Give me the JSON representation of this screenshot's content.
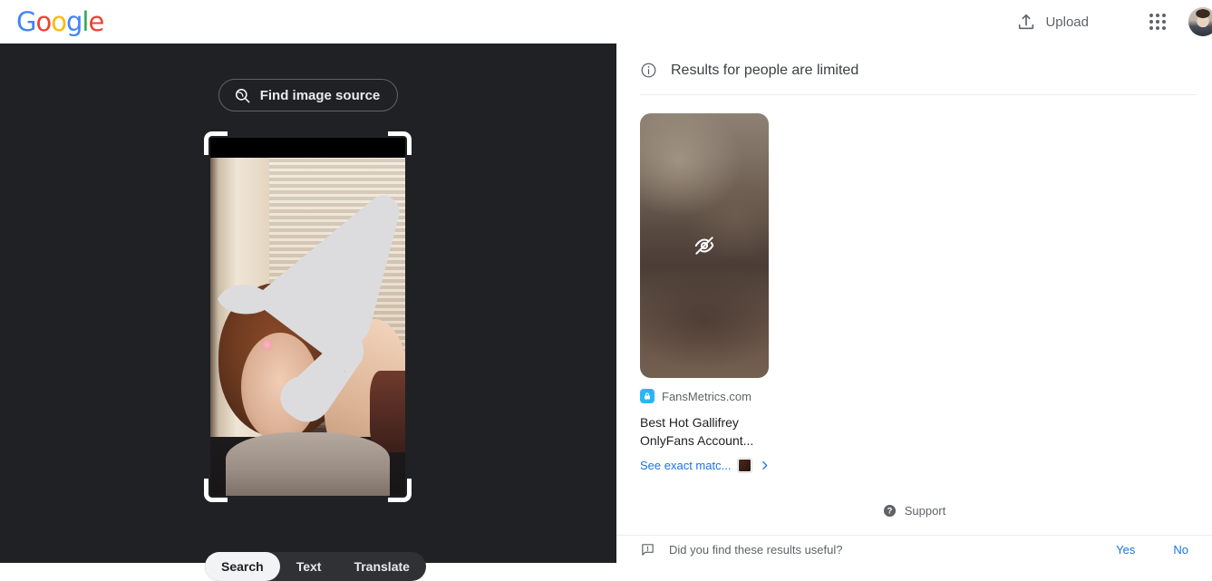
{
  "topbar": {
    "logo_text": "Google",
    "logo_letters": [
      "G",
      "o",
      "o",
      "g",
      "l",
      "e"
    ],
    "upload_label": "Upload",
    "upload_icon": "upload-arrow-icon",
    "apps_icon": "apps-grid-icon",
    "avatar_icon": "account-avatar"
  },
  "left_panel": {
    "find_image_source_label": "Find image source",
    "find_image_source_icon": "image-search-lens-icon",
    "crop_handles": [
      "top-left",
      "top-right",
      "bottom-left",
      "bottom-right"
    ],
    "tabs": [
      {
        "label": "Search",
        "active": true
      },
      {
        "label": "Text",
        "active": false
      },
      {
        "label": "Translate",
        "active": false
      }
    ]
  },
  "results": {
    "header_text": "Results for people are limited",
    "header_icon": "info-circle-icon",
    "card": {
      "thumbnail_state": "blurred",
      "thumbnail_icon": "visibility-off-icon",
      "source_name": "FansMetrics.com",
      "source_favicon": "lock-favicon",
      "title": "Best Hot Gallifrey OnlyFans Account...",
      "exact_match_label": "See exact matc...",
      "exact_match_chevron": "chevron-right-icon"
    },
    "support": {
      "label": "Support",
      "icon": "help-circle-icon"
    },
    "feedback": {
      "question": "Did you find these results useful?",
      "icon": "feedback-bubble-icon",
      "yes_label": "Yes",
      "no_label": "No"
    }
  },
  "colors": {
    "dark_panel": "#202124",
    "tab_bar": "#303134",
    "link_blue": "#1a73e8",
    "text_grey": "#5f6368",
    "favicon_blue": "#29b6f6"
  }
}
